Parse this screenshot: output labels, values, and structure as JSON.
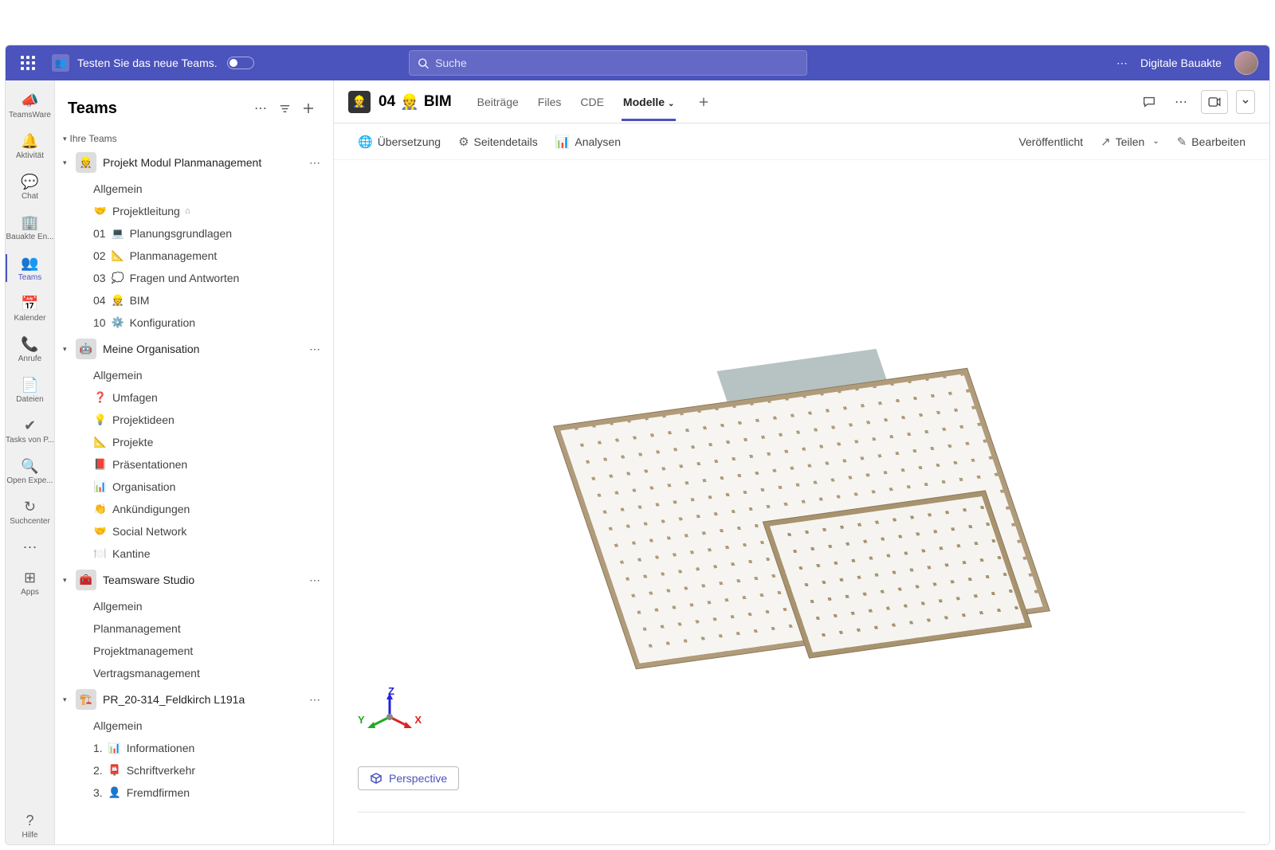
{
  "topbar": {
    "try_new_teams": "Testen Sie das neue Teams.",
    "search_placeholder": "Suche",
    "account_label": "Digitale Bauakte"
  },
  "rail": [
    {
      "id": "teamsware",
      "label": "TeamsWare",
      "icon": "📣"
    },
    {
      "id": "activity",
      "label": "Aktivität",
      "icon": "🔔"
    },
    {
      "id": "chat",
      "label": "Chat",
      "icon": "💬"
    },
    {
      "id": "bauakte",
      "label": "Bauakte En...",
      "icon": "🏢"
    },
    {
      "id": "teams",
      "label": "Teams",
      "icon": "👥",
      "active": true
    },
    {
      "id": "calendar",
      "label": "Kalender",
      "icon": "📅"
    },
    {
      "id": "calls",
      "label": "Anrufe",
      "icon": "📞"
    },
    {
      "id": "files",
      "label": "Dateien",
      "icon": "📄"
    },
    {
      "id": "tasks",
      "label": "Tasks von P...",
      "icon": "✔"
    },
    {
      "id": "openexp",
      "label": "Open Expe...",
      "icon": "🔍"
    },
    {
      "id": "search",
      "label": "Suchcenter",
      "icon": "↻"
    },
    {
      "id": "more",
      "label": "",
      "icon": "⋯"
    },
    {
      "id": "apps",
      "label": "Apps",
      "icon": "⊞"
    }
  ],
  "rail_help": {
    "label": "Hilfe",
    "icon": "?"
  },
  "sidebar": {
    "title": "Teams",
    "your_teams_label": "Ihre Teams",
    "teams": [
      {
        "name": "Projekt Modul Planmanagement",
        "avatar": "👷",
        "channels": [
          {
            "label": "Allgemein"
          },
          {
            "emoji": "🤝",
            "label": "Projektleitung",
            "private": true
          },
          {
            "prefix": "01",
            "emoji": "💻",
            "label": "Planungsgrundlagen"
          },
          {
            "prefix": "02",
            "emoji": "📐",
            "label": "Planmanagement"
          },
          {
            "prefix": "03",
            "emoji": "💭",
            "label": "Fragen und Antworten"
          },
          {
            "prefix": "04",
            "emoji": "👷",
            "label": "BIM",
            "active": true
          },
          {
            "prefix": "10",
            "emoji": "⚙️",
            "label": "Konfiguration"
          }
        ]
      },
      {
        "name": "Meine Organisation",
        "avatar": "🤖",
        "channels": [
          {
            "label": "Allgemein"
          },
          {
            "emoji": "❓",
            "label": "Umfagen"
          },
          {
            "emoji": "💡",
            "label": "Projektideen"
          },
          {
            "emoji": "📐",
            "label": "Projekte"
          },
          {
            "emoji": "📕",
            "label": "Präsentationen"
          },
          {
            "emoji": "📊",
            "label": "Organisation"
          },
          {
            "emoji": "👏",
            "label": "Ankündigungen"
          },
          {
            "emoji": "🤝",
            "label": "Social Network"
          },
          {
            "emoji": "🍽️",
            "label": "Kantine"
          }
        ]
      },
      {
        "name": "Teamsware Studio",
        "avatar": "🧰",
        "channels": [
          {
            "label": "Allgemein"
          },
          {
            "label": "Planmanagement"
          },
          {
            "label": "Projektmanagement"
          },
          {
            "label": "Vertragsmanagement"
          }
        ]
      },
      {
        "name": "PR_20-314_Feldkirch L191a",
        "avatar": "🏗️",
        "channels": [
          {
            "label": "Allgemein"
          },
          {
            "prefix": "1.",
            "emoji": "📊",
            "label": "Informationen"
          },
          {
            "prefix": "2.",
            "emoji": "📮",
            "label": "Schriftverkehr"
          },
          {
            "prefix": "3.",
            "emoji": "👤",
            "label": "Fremdfirmen"
          }
        ]
      }
    ]
  },
  "header": {
    "channel_prefix": "04",
    "channel_emoji": "👷",
    "channel_name": "BIM",
    "tabs": [
      {
        "label": "Beiträge"
      },
      {
        "label": "Files"
      },
      {
        "label": "CDE"
      },
      {
        "label": "Modelle",
        "active": true,
        "dropdown": true
      }
    ]
  },
  "toolbar": {
    "translate": "Übersetzung",
    "details": "Seitendetails",
    "analytics": "Analysen",
    "published": "Veröffentlicht",
    "share": "Teilen",
    "edit": "Bearbeiten"
  },
  "viewer": {
    "axes": {
      "x": "X",
      "y": "Y",
      "z": "Z"
    },
    "perspective_label": "Perspective"
  }
}
